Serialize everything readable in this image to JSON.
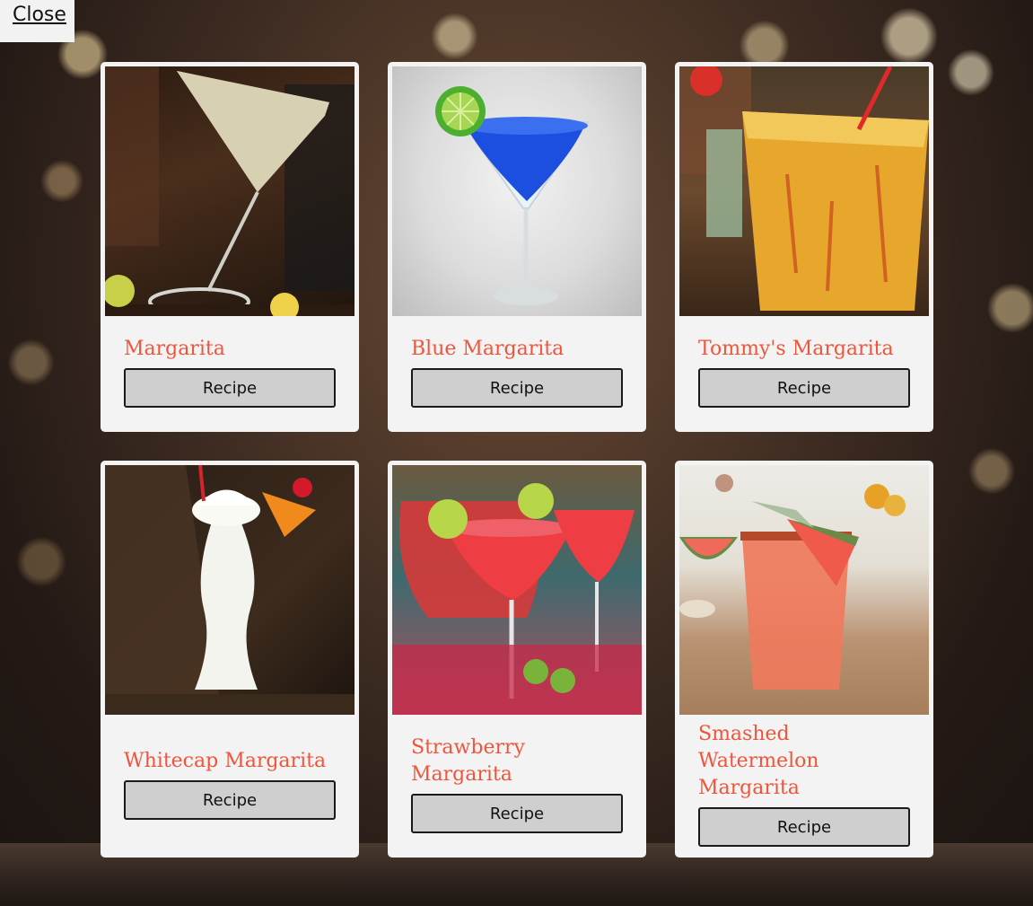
{
  "close_label": "Close",
  "recipe_label": "Recipe",
  "cards": [
    {
      "name": "Margarita"
    },
    {
      "name": "Blue Margarita"
    },
    {
      "name": "Tommy's Margarita"
    },
    {
      "name": "Whitecap Margarita"
    },
    {
      "name": "Strawberry Margarita"
    },
    {
      "name": "Smashed Watermelon Margarita"
    }
  ],
  "colors": {
    "title": "#f0553c",
    "card_bg": "#f3f3f3",
    "button_bg": "#cfcfcf"
  }
}
